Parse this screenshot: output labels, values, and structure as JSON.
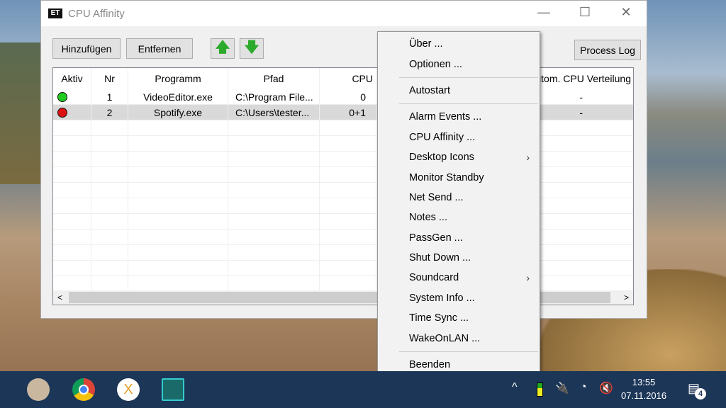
{
  "window": {
    "title": "CPU Affinity",
    "minimize": "—",
    "maximize": "☐",
    "close": "✕"
  },
  "toolbar": {
    "add": "Hinzufügen",
    "remove": "Entfernen",
    "up_icon": "arrow-up",
    "down_icon": "arrow-down",
    "process_log": "Process Log"
  },
  "table": {
    "columns": [
      "Aktiv",
      "Nr",
      "Programm",
      "Pfad",
      "CPU",
      "Autom. CPU Verteilung"
    ],
    "rows": [
      {
        "active": true,
        "nr": "1",
        "program": "VideoEditor.exe",
        "path": "C:\\Program File...",
        "cpu": "0",
        "auto": "-"
      },
      {
        "active": false,
        "nr": "2",
        "program": "Spotify.exe",
        "path": "C:\\Users\\tester...",
        "cpu": "0+1",
        "auto": "-"
      }
    ],
    "active_color": "#22cc22",
    "inactive_color": "#dd1111"
  },
  "menu": {
    "items": [
      {
        "label": "Über ..."
      },
      {
        "label": "Optionen ..."
      },
      {
        "sep": true
      },
      {
        "label": "Autostart"
      },
      {
        "sep": true
      },
      {
        "label": "Alarm Events ..."
      },
      {
        "label": "CPU Affinity ..."
      },
      {
        "label": "Desktop Icons",
        "submenu": true
      },
      {
        "label": "Monitor Standby"
      },
      {
        "label": "Net Send ..."
      },
      {
        "label": "Notes ..."
      },
      {
        "label": "PassGen ..."
      },
      {
        "label": "Shut Down ..."
      },
      {
        "label": "Soundcard",
        "submenu": true
      },
      {
        "label": "System Info ..."
      },
      {
        "label": "Time Sync ..."
      },
      {
        "label": "WakeOnLAN ..."
      },
      {
        "sep": true
      },
      {
        "label": "Beenden"
      }
    ]
  },
  "taskbar": {
    "time": "13:55",
    "date": "07.11.2016",
    "notifications": "4"
  }
}
